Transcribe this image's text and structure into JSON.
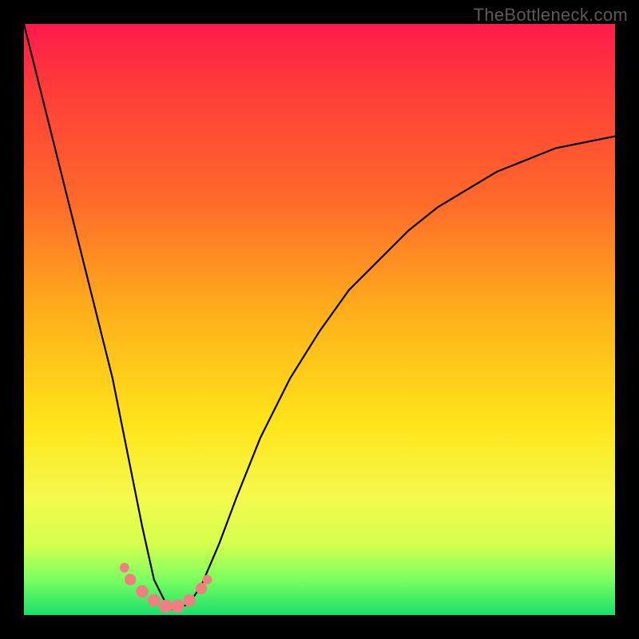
{
  "watermark": "TheBottleneck.com",
  "chart_data": {
    "type": "line",
    "title": "",
    "xlabel": "",
    "ylabel": "",
    "xlim": [
      0,
      100
    ],
    "ylim": [
      0,
      100
    ],
    "series": [
      {
        "name": "curve",
        "x": [
          0,
          5,
          10,
          15,
          17,
          20,
          22,
          24,
          25,
          26,
          28,
          30,
          33,
          36,
          40,
          45,
          50,
          55,
          60,
          65,
          70,
          75,
          80,
          85,
          90,
          95,
          100
        ],
        "values": [
          100,
          80,
          60,
          40,
          30,
          15,
          6,
          2,
          1,
          1,
          2,
          5,
          12,
          20,
          30,
          40,
          48,
          55,
          60,
          65,
          69,
          72,
          75,
          77,
          79,
          80,
          81
        ]
      }
    ],
    "markers": [
      {
        "x": 17,
        "y": 8,
        "r": 1.0
      },
      {
        "x": 18,
        "y": 6,
        "r": 1.2
      },
      {
        "x": 20,
        "y": 4,
        "r": 1.3
      },
      {
        "x": 22,
        "y": 2.5,
        "r": 1.3
      },
      {
        "x": 24,
        "y": 1.5,
        "r": 1.4
      },
      {
        "x": 26,
        "y": 1.5,
        "r": 1.4
      },
      {
        "x": 28,
        "y": 2.5,
        "r": 1.3
      },
      {
        "x": 30,
        "y": 4.5,
        "r": 1.2
      },
      {
        "x": 31,
        "y": 6,
        "r": 1.0
      }
    ],
    "marker_color": "#f08080",
    "curve_color": "#000000"
  }
}
